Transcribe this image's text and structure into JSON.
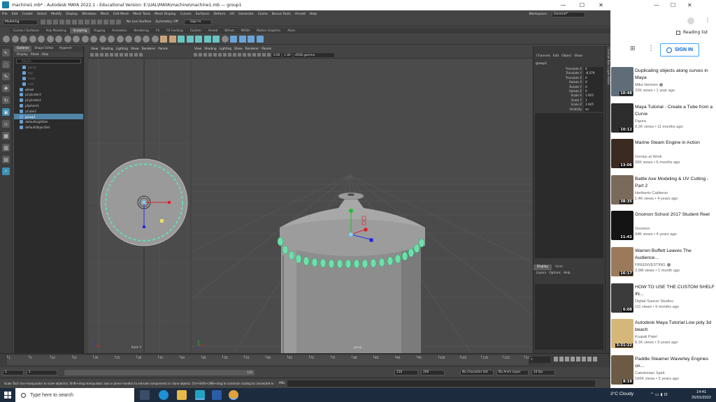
{
  "maya": {
    "title": "machine1.mb* - Autodesk MAYA 2022.1 - Educational Version: E:\\UAL\\MAYA\\machine\\machine1.mb  ---  group1",
    "window_controls": [
      "—",
      "☐",
      "✕"
    ],
    "menus": [
      "File",
      "Edit",
      "Create",
      "Select",
      "Modify",
      "Display",
      "Windows",
      "Mesh",
      "Edit Mesh",
      "Mesh Tools",
      "Mesh Display",
      "Curves",
      "Surfaces",
      "Deform",
      "UV",
      "Generate",
      "Cache",
      "Bonus Tools",
      "Arnold",
      "Help"
    ],
    "workspace_label": "Workspace:",
    "workspace_value": "General*",
    "mode": "Modeling",
    "no_live_surface": "No Live Surface",
    "symmetry": "Symmetry: Off",
    "sign_in": "Sign In",
    "shelf_tabs": [
      "Curves / Surfaces",
      "Poly Modeling",
      "Sculpting",
      "Rigging",
      "Animation",
      "Rendering",
      "FX",
      "FX Caching",
      "Custom",
      "Arnold",
      "Bifrost",
      "MASH",
      "Motion Graphics",
      "XGen"
    ],
    "shelf_active": "Sculpting",
    "outliner": {
      "tabs": [
        "Outliner",
        "Shape Editor",
        "Hypersh"
      ],
      "menu": [
        "Display",
        "Show",
        "Help"
      ],
      "search_placeholder": "Search...",
      "items": [
        {
          "label": "persp",
          "state": "dim"
        },
        {
          "label": "top",
          "state": "dim"
        },
        {
          "label": "front",
          "state": "dim"
        },
        {
          "label": "side",
          "state": "dim"
        },
        {
          "label": "wheel",
          "state": "normal"
        },
        {
          "label": "pCylinder3",
          "state": "normal"
        },
        {
          "label": "pCylinder4",
          "state": "normal"
        },
        {
          "label": "pSphere1",
          "state": "normal"
        },
        {
          "label": "pCube1",
          "state": "normal"
        },
        {
          "label": "group1",
          "state": "selected"
        },
        {
          "label": "defaultLightSet",
          "state": "normal"
        },
        {
          "label": "defaultObjectSet",
          "state": "normal"
        }
      ]
    },
    "viewport_menu": [
      "View",
      "Shading",
      "Lighting",
      "Show",
      "Renderer",
      "Panels"
    ],
    "viewport_left_camera": "front -Y",
    "viewport_right_camera": "persp",
    "viewport_fields": [
      "0.00",
      "1.00"
    ],
    "color_space": "sRGB gamma",
    "channel_box": {
      "menu": [
        "Channels",
        "Edit",
        "Object",
        "Show"
      ],
      "object": "group1",
      "channels": [
        {
          "label": "Translate X",
          "value": "0"
        },
        {
          "label": "Translate Y",
          "value": "-8.579"
        },
        {
          "label": "Translate Z",
          "value": "0"
        },
        {
          "label": "Rotate X",
          "value": "0"
        },
        {
          "label": "Rotate Y",
          "value": "0"
        },
        {
          "label": "Rotate Z",
          "value": "0"
        },
        {
          "label": "Scale X",
          "value": "1.925"
        },
        {
          "label": "Scale Y",
          "value": "1"
        },
        {
          "label": "Scale Z",
          "value": "1.925"
        },
        {
          "label": "Visibility",
          "value": "on"
        }
      ],
      "layer_tabs": [
        "Display",
        "Anim"
      ],
      "layer_menu": [
        "Layers",
        "Options",
        "Help"
      ],
      "side_label": "Channel Box / Layer Editor"
    },
    "timeline": {
      "ticks": [
        "1",
        "5",
        "10",
        "15",
        "20",
        "25",
        "30",
        "35",
        "40",
        "45",
        "50",
        "55",
        "60",
        "65",
        "70",
        "75",
        "80",
        "85",
        "90",
        "95",
        "100",
        "105",
        "110",
        "115",
        "120"
      ],
      "current_frame": "1"
    },
    "range": {
      "start": "1",
      "start2": "1",
      "slider_end": "120",
      "end": "120",
      "anim_end": "200",
      "character_set": "No Character Set",
      "anim_layer": "No Anim Layer",
      "fps": "24 fps"
    },
    "help_line": "Scale Tool: Use manipulator to scale object(s). Shift+drag manipulator axis or plane handles to extrude components or clone objects. Ctrl+Shift+LMB+drag to constrain scaling to connected edges. Use D or INSERT",
    "mel": "MEL"
  },
  "browser": {
    "reading_list": "Reading list",
    "sign_in": "SIGN IN",
    "videos": [
      {
        "title": "Duplicating objects along curves in Maya",
        "channel": "Mike Hermes",
        "verified": true,
        "meta": "22K views • 1 year ago",
        "duration": "10:48",
        "color": "#5e6d78"
      },
      {
        "title": "Maya Tutorial - Create a Tube from a Curve",
        "channel": "Figura",
        "verified": false,
        "meta": "8.2K views • 11 months ago",
        "duration": "10:12",
        "color": "#2d2d2d"
      },
      {
        "title": "Marine Steam Engine in Action",
        "channel": "Genius at Work",
        "verified": false,
        "meta": "26K views • 6 months ago",
        "duration": "13:06",
        "color": "#3a2a22"
      },
      {
        "title": "Battle Axe Modeling & UV Cutting - Part 2",
        "channel": "Heriberto Calderon",
        "verified": false,
        "meta": "1.4K views • 4 years ago",
        "duration": "38:35",
        "color": "#7a6a5a"
      },
      {
        "title": "Gnomon School 2017 Student Reel",
        "channel": "Gnomon",
        "verified": false,
        "meta": "94K views • 4 years ago",
        "duration": "11:42",
        "color": "#141414"
      },
      {
        "title": "Warren Buffett Leaves The Audience...",
        "channel": "FREENVESTING",
        "verified": true,
        "meta": "3.9M views • 1 month ago",
        "duration": "16:17",
        "color": "#9a7a5a"
      },
      {
        "title": "HOW TO USE THE CUSTOM SHELF IN...",
        "channel": "Digital Saucer Studios",
        "verified": false,
        "meta": "111 views • 9 months ago",
        "duration": "6:08",
        "color": "#3b3b3b"
      },
      {
        "title": "Autodesk Maya Tutorial Low poly 3d beach",
        "channel": "Krupali Patel",
        "verified": false,
        "meta": "8.1K views • 3 years ago",
        "duration": "3:31:22",
        "color": "#d6b77a"
      },
      {
        "title": "Paddle Steamer Waverley Engines on...",
        "channel": "Caledonian Spirit",
        "verified": false,
        "meta": "166K views • 5 years ago",
        "duration": "8:19",
        "color": "#6b5a44"
      }
    ]
  },
  "taskbar": {
    "search_placeholder": "Type here to search",
    "weather": "3°C  Cloudy",
    "time": "14:41",
    "date": "25/01/2022"
  }
}
